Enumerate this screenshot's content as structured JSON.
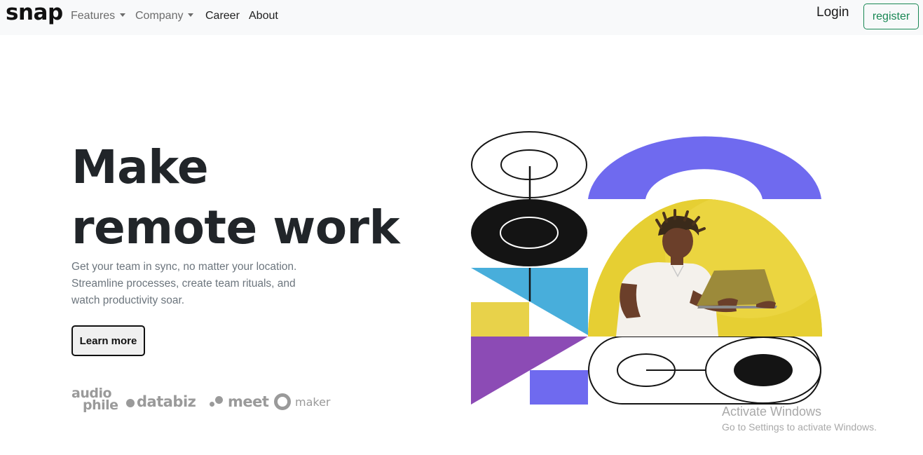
{
  "nav": {
    "brand": "snap",
    "items": [
      {
        "label": "Features",
        "dropdown": true
      },
      {
        "label": "Company",
        "dropdown": true
      },
      {
        "label": "Career",
        "dropdown": false
      },
      {
        "label": "About",
        "dropdown": false
      }
    ],
    "login_label": "Login",
    "register_label": "register"
  },
  "hero": {
    "title_line1": "Make",
    "title_line2": "remote work",
    "description": "Get your team in sync, no matter your location. Streamline processes, create team rituals, and watch productivity soar.",
    "cta_label": "Learn more"
  },
  "clients": {
    "audiophile_line1": "audio",
    "audiophile_line2": "phile",
    "databiz": "databiz",
    "meet": "meet",
    "maker": "maker"
  },
  "illustration": {
    "icon": "hero-illustration",
    "colors": {
      "purple": "#6f6aef",
      "yellow": "#e8d24a",
      "blue": "#48aedb",
      "violet": "#8c4bb5",
      "black": "#141414"
    }
  },
  "watermark": {
    "title": "Activate Windows",
    "subtitle": "Go to Settings to activate Windows."
  },
  "colors": {
    "nav_bg": "#f8f9fa",
    "register_border": "#198754",
    "text_dark": "#212529",
    "text_muted": "#6c757d"
  }
}
